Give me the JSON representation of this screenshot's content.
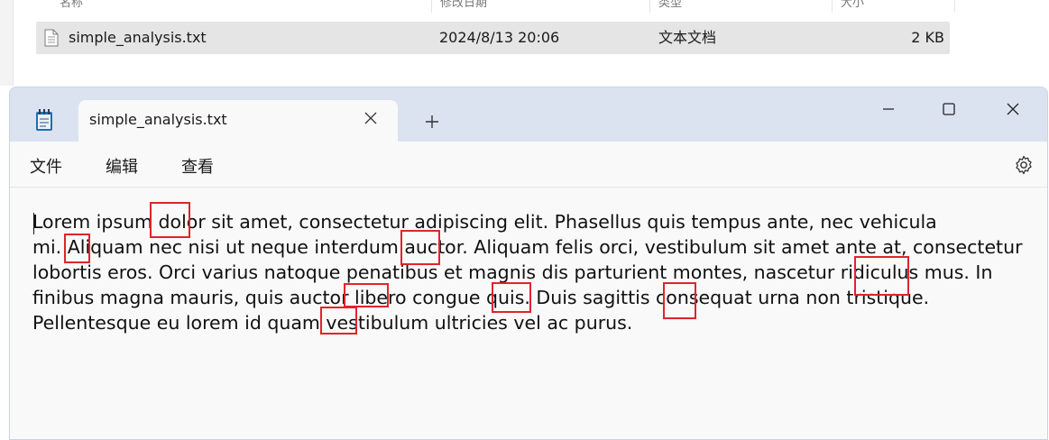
{
  "explorer": {
    "header": {
      "name": "名称",
      "modified": "修改日期",
      "type": "类型",
      "size": "大小"
    },
    "file": {
      "name": "simple_analysis.txt",
      "modified": "2024/8/13 20:06",
      "type": "文本文档",
      "size": "2 KB"
    }
  },
  "notepad": {
    "tab_title": "simple_analysis.txt",
    "menu": {
      "file": "文件",
      "edit": "编辑",
      "view": "查看"
    },
    "lines": [
      "Lorem ipsum dolor sit amet, consectetur adipiscing elit. Phasellus quis tempus ante, nec vehicula",
      "mi. Aliquam nec nisi ut neque interdum auctor. Aliquam felis orci, vestibulum sit amet ante at, consectetur",
      "lobortis eros. Orci varius natoque penatibus et magnis dis parturient montes, nascetur ridiculus mus. In",
      "finibus magna mauris, quis auctor libero congue quis. Duis sagittis consequat urna non tristique.",
      "Pellentesque eu lorem id quam vestibulum ultricies vel ac purus."
    ],
    "highlight_color": "#e0242b"
  }
}
